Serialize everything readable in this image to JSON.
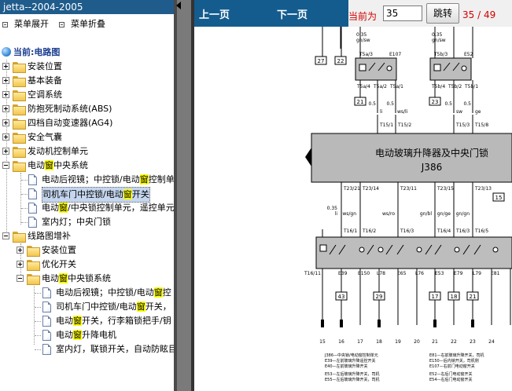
{
  "window": {
    "title": "jetta--2004-2005"
  },
  "menu": {
    "expand": "菜单展开",
    "collapse": "菜单折叠"
  },
  "tree": {
    "current": "当前:电路图",
    "top": [
      {
        "label": "安装位置"
      },
      {
        "label": "基本装备"
      },
      {
        "label": "空调系统"
      },
      {
        "label": "防抱死制动系统(ABS)"
      },
      {
        "label": "四档自动变速器(AG4)"
      },
      {
        "label": "安全气囊"
      },
      {
        "label": "发动机控制单元"
      }
    ],
    "central": {
      "pre": "电动",
      "hl": "窗",
      "post": "中央系统",
      "items": [
        {
          "p1": "电动后视镜；中控锁/电动",
          "h": "窗",
          "p2": "控制单元"
        },
        {
          "p1": "司机车门中控锁/电动",
          "h": "窗",
          "p2": "开关"
        },
        {
          "p1": "电动",
          "h": "窗",
          "p2": "/中央锁控制单元，遥控单元"
        },
        {
          "p1": "室内灯；中央门锁",
          "h": "",
          "p2": ""
        }
      ]
    },
    "supplement": {
      "label": "线路图增补",
      "children": [
        {
          "label": "安装位置"
        },
        {
          "label": "优化开关"
        }
      ],
      "sub": {
        "pre": "电动",
        "hl": "窗",
        "post": "中央锁系统",
        "items": [
          {
            "p1": "电动后视镜；中控锁/电动",
            "h": "窗",
            "p2": "控"
          },
          {
            "p1": "司机车门中控锁/电动",
            "h": "窗",
            "p2": "开关，"
          },
          {
            "p1": "电动",
            "h": "窗",
            "p2": "开关，行李箱锁把手/钥"
          },
          {
            "p1": "电动",
            "h": "窗",
            "p2": "升降电机"
          },
          {
            "p1": "室内灯，联锁开关，自动防眩目",
            "h": "",
            "p2": ""
          }
        ]
      }
    }
  },
  "viewer": {
    "prev": "上一页",
    "next": "下一页",
    "current_label": "当前为",
    "page_value": "35",
    "go": "跳转",
    "count": "35 / 49"
  },
  "diagram": {
    "module_title": "电动玻璃升降器及中央门锁",
    "module_id": "J386",
    "top_terminals": [
      "27",
      "22",
      "21",
      "23"
    ],
    "top_connectors": [
      "T5a/3",
      "E107",
      "T5b/3",
      "E52",
      "T5a/4",
      "T5a/2",
      "T5a/1",
      "T5b/4",
      "T5b/2",
      "T5b/1"
    ],
    "wire_sizes_top": [
      "0.35",
      "gn/sw",
      "0.35",
      "gn/sw",
      "0.5",
      "0.5",
      "0.5",
      "0.5"
    ],
    "upper_pins": [
      "T15/1",
      "T15/2",
      "T15/3",
      "T15/8"
    ],
    "upper_colors": [
      "li",
      "ws/li",
      "sw",
      "ge"
    ],
    "lower_pins": [
      "T23/21",
      "T23/14",
      "T23/11",
      "T23/15",
      "T23/13",
      "T23/2"
    ],
    "lower_wire_colors": [
      "0.35",
      "li",
      "ws/gn",
      "ws/ro",
      "gn/bl",
      "gn/ge",
      "gn/gn"
    ],
    "switch_pins": [
      "T16/1",
      "T16/2",
      "T16/3",
      "T16/4",
      "T16/3",
      "T16/5"
    ],
    "switch_labels": [
      "T16/11",
      "E39",
      "E150",
      "L78",
      "E65",
      "L76",
      "E53",
      "E79",
      "L79",
      "E81"
    ],
    "bottom_labels": [
      "43",
      "29",
      "17",
      "18",
      "21"
    ],
    "bottom_numbers": [
      "15",
      "16",
      "17",
      "18",
      "19",
      "20",
      "21",
      "22",
      "23",
      "24"
    ],
    "legend_left": [
      "J386—中央锁/电动窗控制单元",
      "E39—左前玻璃升降遥控开关",
      "E40—左前玻璃升降开关",
      "E53—左后玻璃升降开关，司机",
      "E55—左后玻璃升降开关，司机"
    ],
    "legend_right": [
      "E81—右前玻璃升降开关，司机",
      "E150—后内锁开关，司机侧",
      "E107—右前门电动窗开关",
      "E52—右后门电动窗开关",
      "E54—右后门电动窗开关"
    ],
    "wire_number_15": "15",
    "wire_number_15r": "15"
  }
}
